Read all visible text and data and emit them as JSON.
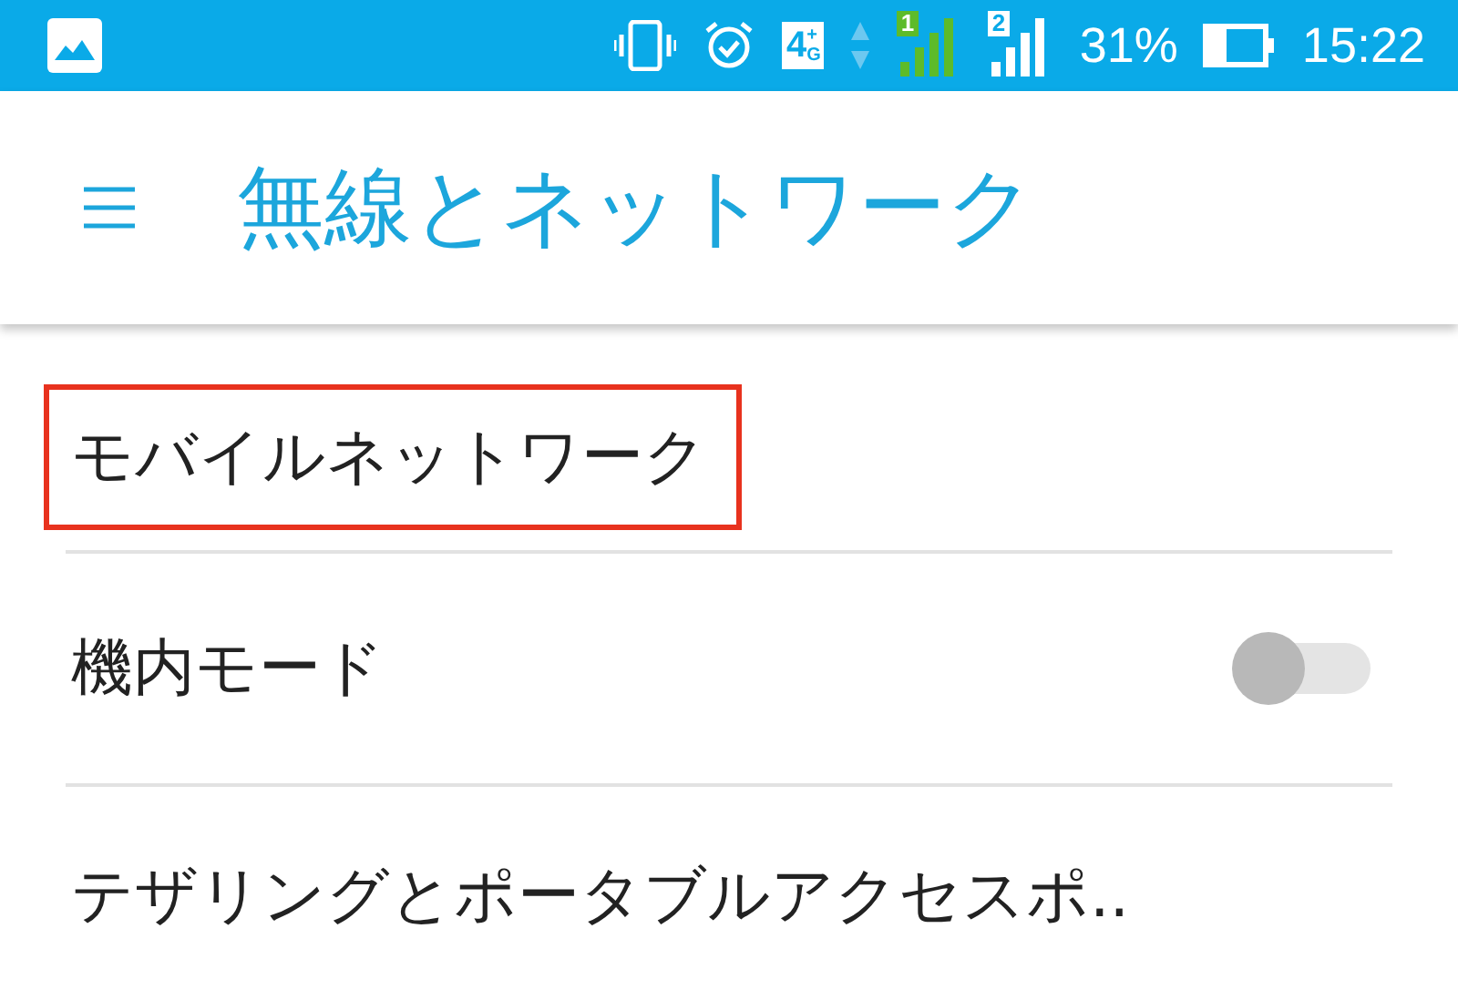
{
  "status_bar": {
    "network_badge": {
      "main": "4",
      "top": "+",
      "bottom": "G"
    },
    "sim1_label": "1",
    "sim2_label": "2",
    "battery": "31%",
    "time": "15:22"
  },
  "app_bar": {
    "title": "無線とネットワーク"
  },
  "items": [
    {
      "kind": "link",
      "label": "モバイルネットワーク",
      "highlighted": true
    },
    {
      "kind": "toggle",
      "label": "機内モード",
      "on": false,
      "highlighted": false
    },
    {
      "kind": "link",
      "label": "テザリングとポータブルアクセスポ..",
      "highlighted": false
    }
  ]
}
